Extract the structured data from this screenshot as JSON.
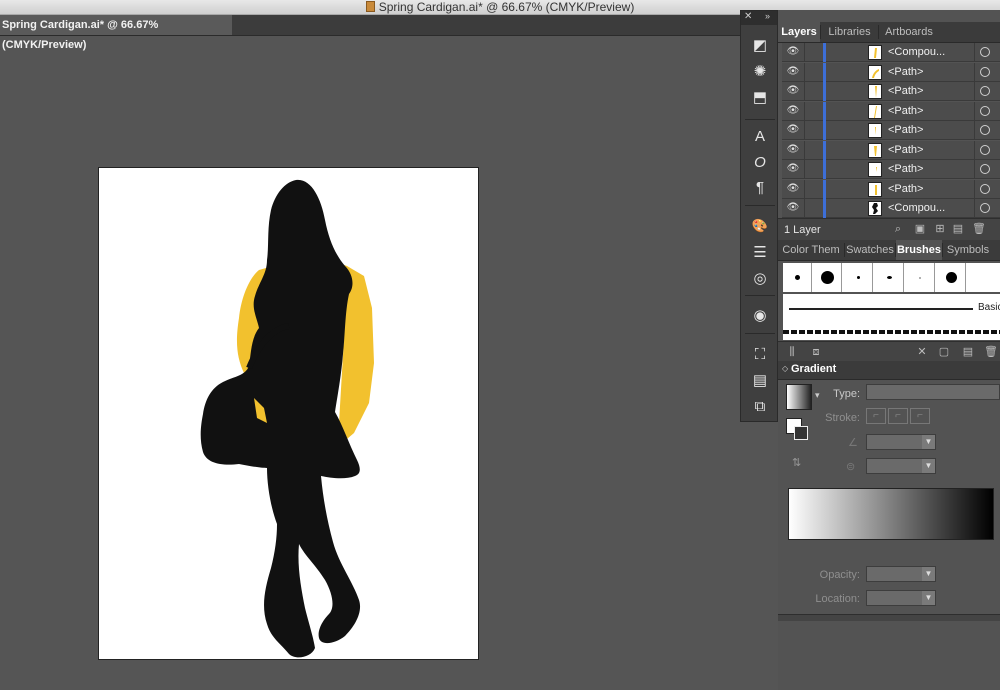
{
  "window": {
    "title": "Spring Cardigan.ai* @ 66.67% (CMYK/Preview)"
  },
  "document_tab": {
    "label": "Spring Cardigan.ai* @ 66.67% (CMYK/Preview)"
  },
  "colors": {
    "canvas_bg": "#555555",
    "artboard": "#ffffff",
    "silhouette": "#111111",
    "cardigan_yellow": "#f2c12e",
    "layer_color_bar": "#3d6fd8"
  },
  "tools": [
    {
      "icon": "artboard-icon",
      "glyph": "◩"
    },
    {
      "icon": "sun-icon",
      "glyph": "✺"
    },
    {
      "icon": "export-icon",
      "glyph": "⬒"
    },
    {
      "icon": "character-icon",
      "glyph": "A"
    },
    {
      "icon": "opentype-icon",
      "glyph": "O"
    },
    {
      "icon": "paragraph-icon",
      "glyph": "¶"
    },
    {
      "icon": "swatch-libraries-icon",
      "glyph": "🎨"
    },
    {
      "icon": "stroke-icon",
      "glyph": "☰"
    },
    {
      "icon": "transparency-icon",
      "glyph": "◎"
    },
    {
      "icon": "appearance-icon",
      "glyph": "◉"
    },
    {
      "icon": "transform-icon",
      "glyph": "⛶"
    },
    {
      "icon": "align-icon",
      "glyph": "▤"
    },
    {
      "icon": "pathfinder-icon",
      "glyph": "⧉"
    }
  ],
  "panels": {
    "layers_group": {
      "tabs": [
        "Layers",
        "Libraries",
        "Artboards"
      ],
      "active": "Layers"
    },
    "layers": {
      "rows": [
        {
          "name": "<Compou...",
          "icon": "eye-icon"
        },
        {
          "name": "<Path>",
          "icon": "eye-icon"
        },
        {
          "name": "<Path>",
          "icon": "eye-icon"
        },
        {
          "name": "<Path>",
          "icon": "eye-icon"
        },
        {
          "name": "<Path>",
          "icon": "eye-icon"
        },
        {
          "name": "<Path>",
          "icon": "eye-icon"
        },
        {
          "name": "<Path>",
          "icon": "eye-icon"
        },
        {
          "name": "<Path>",
          "icon": "eye-icon"
        },
        {
          "name": "<Compou...",
          "icon": "eye-icon"
        }
      ],
      "footer_count": "1 Layer"
    },
    "brushes_group": {
      "tabs": [
        "Color Them",
        "Swatches",
        "Brushes",
        "Symbols"
      ],
      "active": "Brushes",
      "basic_label": "Basic"
    },
    "gradient": {
      "title": "Gradient",
      "type_label": "Type:",
      "stroke_label": "Stroke:",
      "opacity_label": "Opacity:",
      "location_label": "Location:",
      "type_value": "",
      "angle_value": "",
      "aspect_value": "",
      "opacity_value": "",
      "location_value": ""
    }
  }
}
